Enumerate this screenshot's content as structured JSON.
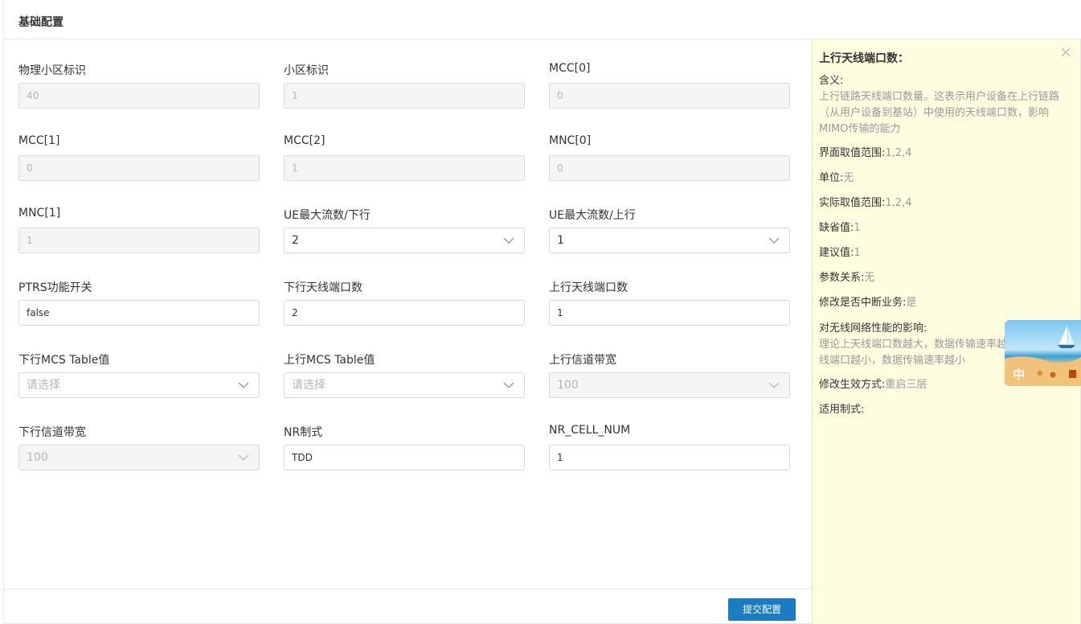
{
  "page": {
    "title": "基础配置"
  },
  "fields": {
    "physical_cell_id": {
      "label": "物理小区标识",
      "value": "40"
    },
    "cell_id": {
      "label": "小区标识",
      "value": "1"
    },
    "mcc0": {
      "label": "MCC[0]",
      "value": "0"
    },
    "mcc1": {
      "label": "MCC[1]",
      "value": "0"
    },
    "mcc2": {
      "label": "MCC[2]",
      "value": "1"
    },
    "mnc0": {
      "label": "MNC[0]",
      "value": "0"
    },
    "mnc1": {
      "label": "MNC[1]",
      "value": "1"
    },
    "ue_max_streams_dl": {
      "label": "UE最大流数/下行",
      "value": "2"
    },
    "ue_max_streams_ul": {
      "label": "UE最大流数/上行",
      "value": "1"
    },
    "ptrs_switch": {
      "label": "PTRS功能开关",
      "value": "false"
    },
    "dl_antenna_ports": {
      "label": "下行天线端口数",
      "value": "2"
    },
    "ul_antenna_ports": {
      "label": "上行天线端口数",
      "value": "1"
    },
    "dl_mcs_table": {
      "label": "下行MCS Table值",
      "placeholder": "请选择"
    },
    "ul_mcs_table": {
      "label": "上行MCS Table值",
      "placeholder": "请选择"
    },
    "ul_bandwidth": {
      "label": "上行信道带宽",
      "value": "100"
    },
    "dl_bandwidth": {
      "label": "下行信道带宽",
      "value": "100"
    },
    "nr_mode": {
      "label": "NR制式",
      "value": "TDD"
    },
    "nr_cell_num": {
      "label": "NR_CELL_NUM",
      "value": "1"
    }
  },
  "footer": {
    "submit_label": "提交配置"
  },
  "help": {
    "title": "上行天线端口数：",
    "meaning_label": "含义:",
    "meaning_text": "上行链路天线端口数量。这表示用户设备在上行链路（从用户设备到基站）中使用的天线端口数，影响MIMO传输的能力",
    "ui_range_label": "界面取值范围:",
    "ui_range_value": "1,2,4",
    "unit_label": "单位:",
    "unit_value": "无",
    "actual_range_label": "实际取值范围:",
    "actual_range_value": "1,2,4",
    "default_label": "缺省值:",
    "default_value": "1",
    "suggest_label": "建议值:",
    "suggest_value": "1",
    "relation_label": "参数关系:",
    "relation_value": "无",
    "interrupt_label": "修改是否中断业务:",
    "interrupt_value": "是",
    "impact_label": "对无线网络性能的影响:",
    "impact_text": "理论上天线端口数越大，数据传输速率越大；反之，天线端口越小，数据传输速率越小",
    "effect_label": "修改生效方式:",
    "effect_value": "重启三层",
    "standard_label": "适用制式:"
  },
  "ime": {
    "mode": "中"
  }
}
